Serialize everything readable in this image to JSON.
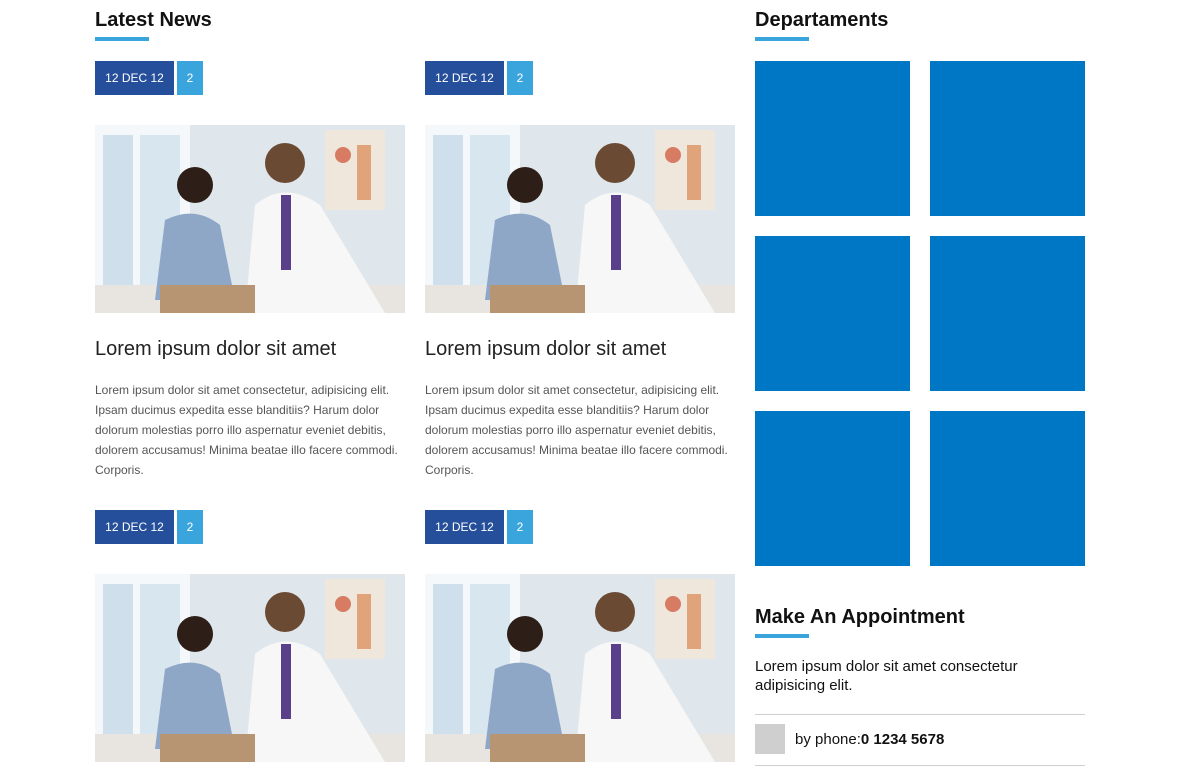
{
  "latest_news": {
    "title": "Latest News",
    "items": [
      {
        "date": "12 DEC 12",
        "comments": "2",
        "headline": "Lorem ipsum dolor sit amet",
        "excerpt": "Lorem ipsum dolor sit amet consectetur, adipisicing elit. Ipsam ducimus expedita esse blanditiis? Harum dolor dolorum molestias porro illo aspernatur eveniet debitis, dolorem accusamus! Minima beatae illo facere commodi. Corporis."
      },
      {
        "date": "12 DEC 12",
        "comments": "2",
        "headline": "Lorem ipsum dolor sit amet",
        "excerpt": "Lorem ipsum dolor sit amet consectetur, adipisicing elit. Ipsam ducimus expedita esse blanditiis? Harum dolor dolorum molestias porro illo aspernatur eveniet debitis, dolorem accusamus! Minima beatae illo facere commodi. Corporis."
      },
      {
        "date": "12 DEC 12",
        "comments": "2"
      },
      {
        "date": "12 DEC 12",
        "comments": "2"
      }
    ]
  },
  "departments": {
    "title": "Departaments",
    "tile_color": "#0077c4",
    "tile_count": 6
  },
  "appointment": {
    "title": "Make An Appointment",
    "text": "Lorem ipsum dolor sit amet consectetur adipisicing elit.",
    "phone_label": "by phone:",
    "phone_number": "0 1234 5678"
  },
  "colors": {
    "accent": "#3aa4dd",
    "date_badge": "#264f9b",
    "tile": "#0077c4"
  },
  "icons": {
    "phone": "phone-icon"
  }
}
